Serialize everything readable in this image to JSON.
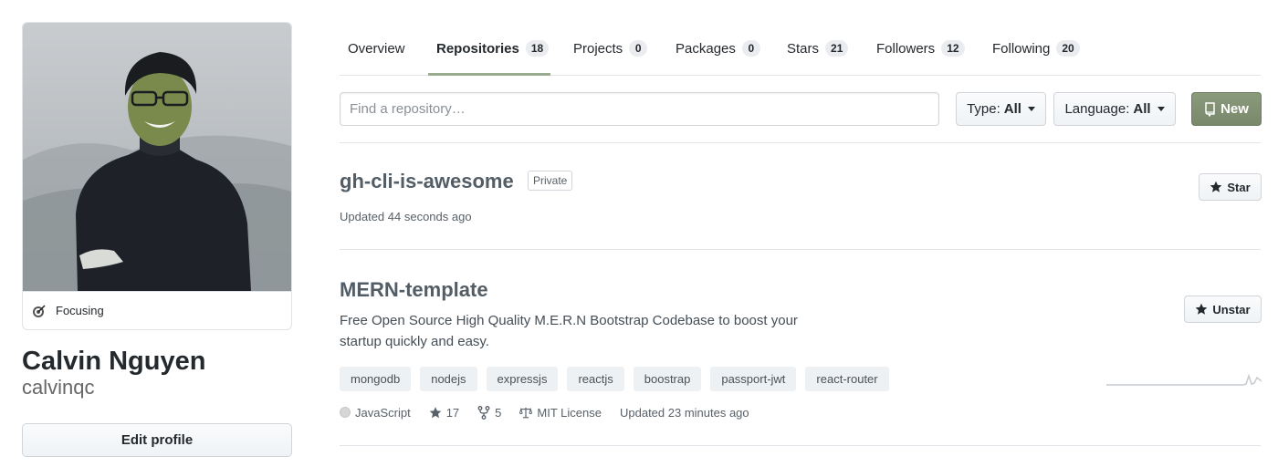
{
  "profile": {
    "status_text": "Focusing",
    "full_name": "Calvin Nguyen",
    "username": "calvinqc",
    "edit_button": "Edit profile"
  },
  "tabs": [
    {
      "label": "Overview",
      "count": null
    },
    {
      "label": "Repositories",
      "count": "18",
      "selected": true
    },
    {
      "label": "Projects",
      "count": "0"
    },
    {
      "label": "Packages",
      "count": "0"
    },
    {
      "label": "Stars",
      "count": "21"
    },
    {
      "label": "Followers",
      "count": "12"
    },
    {
      "label": "Following",
      "count": "20"
    }
  ],
  "filters": {
    "search_placeholder": "Find a repository…",
    "type_label": "Type:",
    "type_value": "All",
    "language_label": "Language:",
    "language_value": "All",
    "new_button": "New"
  },
  "repos": [
    {
      "name": "gh-cli-is-awesome",
      "badge": "Private",
      "updated": "Updated 44 seconds ago",
      "star_button": "Star"
    },
    {
      "name": "MERN-template",
      "description_line1": "Free Open Source High Quality M.E.R.N Bootstrap Codebase to boost your",
      "description_line2": "startup quickly and easy.",
      "topics": [
        "mongodb",
        "nodejs",
        "expressjs",
        "reactjs",
        "boostrap",
        "passport-jwt",
        "react-router"
      ],
      "language": "JavaScript",
      "stars": "17",
      "forks": "5",
      "license": "MIT License",
      "updated": "Updated 23 minutes ago",
      "star_button": "Unstar"
    }
  ],
  "colors": {
    "accent_green": "#7f8f71",
    "tab_underline": "#9aaa8e",
    "repo_link": "#535d66"
  }
}
